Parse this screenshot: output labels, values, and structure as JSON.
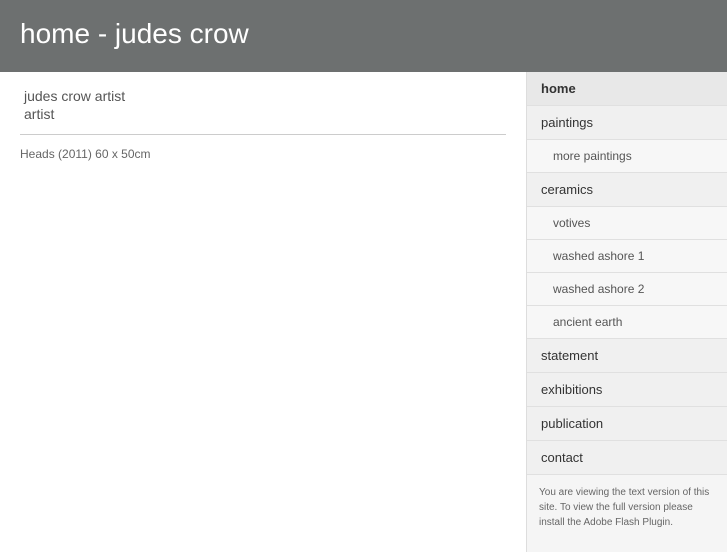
{
  "header": {
    "title": "home - judes crow"
  },
  "main": {
    "site_title": "judes crow artist",
    "site_subtitle": "artist",
    "caption": "Heads (2011) 60 x 50cm"
  },
  "sidebar": {
    "note": "You are viewing the text version of this site. To view the full version please install the Adobe Flash Plugin.",
    "nav": [
      {
        "id": "home",
        "label": "home",
        "level": "top",
        "active": true
      },
      {
        "id": "paintings",
        "label": "paintings",
        "level": "top",
        "active": false
      },
      {
        "id": "more-paintings",
        "label": "more paintings",
        "level": "sub",
        "active": false
      },
      {
        "id": "ceramics",
        "label": "ceramics",
        "level": "top",
        "active": false
      },
      {
        "id": "votives",
        "label": "votives",
        "level": "sub",
        "active": false
      },
      {
        "id": "washed-ashore-1",
        "label": "washed ashore 1",
        "level": "sub",
        "active": false
      },
      {
        "id": "washed-ashore-2",
        "label": "washed ashore 2",
        "level": "sub",
        "active": false
      },
      {
        "id": "ancient-earth",
        "label": "ancient earth",
        "level": "sub",
        "active": false
      },
      {
        "id": "statement",
        "label": "statement",
        "level": "top",
        "active": false
      },
      {
        "id": "exhibitions",
        "label": "exhibitions",
        "level": "top",
        "active": false
      },
      {
        "id": "publication",
        "label": "publication",
        "level": "top",
        "active": false
      },
      {
        "id": "contact",
        "label": "contact",
        "level": "top",
        "active": false
      }
    ]
  }
}
